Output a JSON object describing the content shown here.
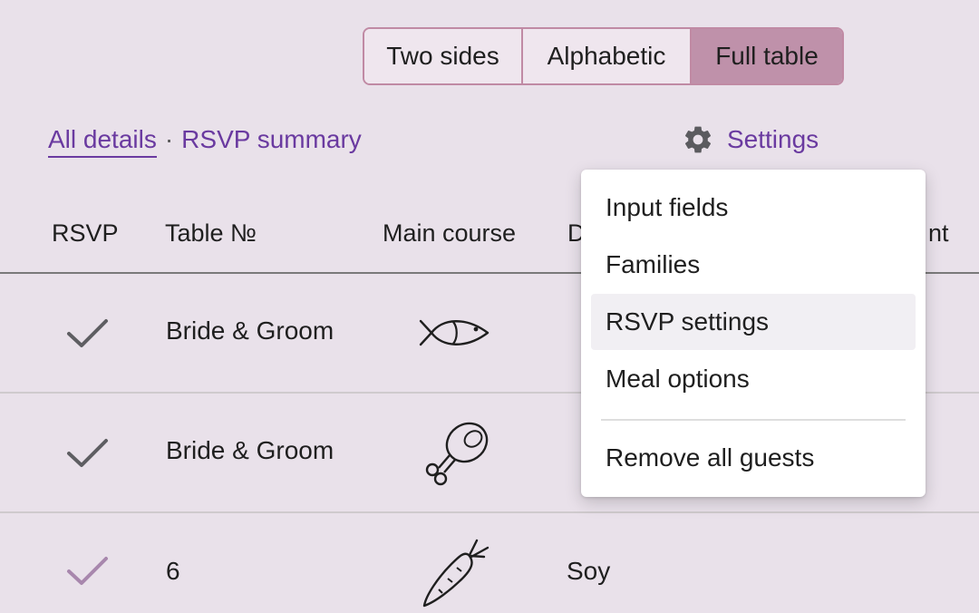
{
  "view_toggle": {
    "options": [
      "Two sides",
      "Alphabetic",
      "Full table"
    ],
    "active": "Full table",
    "active_color": "#bf91aa",
    "border_color": "#c08aa4"
  },
  "links": {
    "all_details": "All details",
    "separator": "·",
    "rsvp_summary": "RSVP summary",
    "link_color": "#6a3aa0"
  },
  "settings": {
    "label": "Settings",
    "icon": "gear-icon"
  },
  "table": {
    "headers": {
      "rsvp": "RSVP",
      "table_no": "Table №",
      "main_course": "Main course",
      "diet_partial": "D",
      "last_partial": "nt"
    },
    "rows": [
      {
        "rsvp_icon": "check-icon",
        "rsvp_color": "#5e5e62",
        "table": "Bride & Groom",
        "main_icon": "fish-icon",
        "diet": ""
      },
      {
        "rsvp_icon": "check-icon",
        "rsvp_color": "#5e5e62",
        "table": "Bride & Groom",
        "main_icon": "meat-icon",
        "diet": ""
      },
      {
        "rsvp_icon": "check-icon",
        "rsvp_color": "#a887ad",
        "table": "6",
        "main_icon": "carrot-icon",
        "diet": "Soy"
      }
    ]
  },
  "dropdown": {
    "items": [
      "Input fields",
      "Families",
      "RSVP settings",
      "Meal options"
    ],
    "highlighted": "RSVP settings",
    "danger_item": "Remove all guests"
  }
}
